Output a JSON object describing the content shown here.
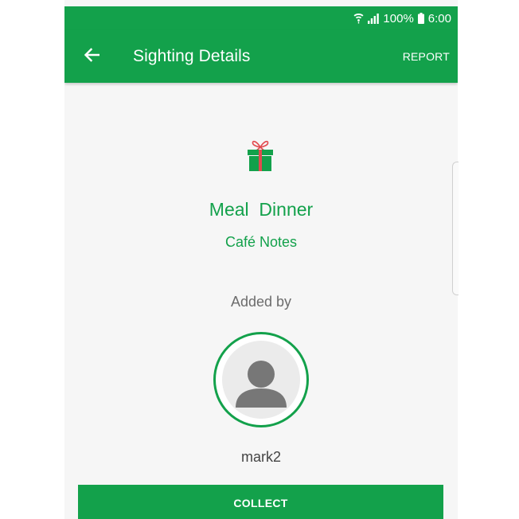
{
  "status_bar": {
    "battery": "100%",
    "time": "6:00",
    "icons": [
      "wifi-icon",
      "signal-icon",
      "battery-icon"
    ]
  },
  "app_bar": {
    "title": "Sighting Details",
    "report_label": "REPORT",
    "back_icon": "back-arrow-icon"
  },
  "item": {
    "icon": "gift-icon",
    "title": "Meal  Dinner",
    "subtitle": "Café Notes"
  },
  "added_by": {
    "label": "Added by",
    "avatar_icon": "person-icon",
    "username": "mark2"
  },
  "actions": {
    "collect_label": "COLLECT"
  },
  "colors": {
    "primary": "#13a14b",
    "gift_red": "#e34a4f",
    "gift_green": "#13a14b",
    "avatar_gray": "#777777"
  }
}
